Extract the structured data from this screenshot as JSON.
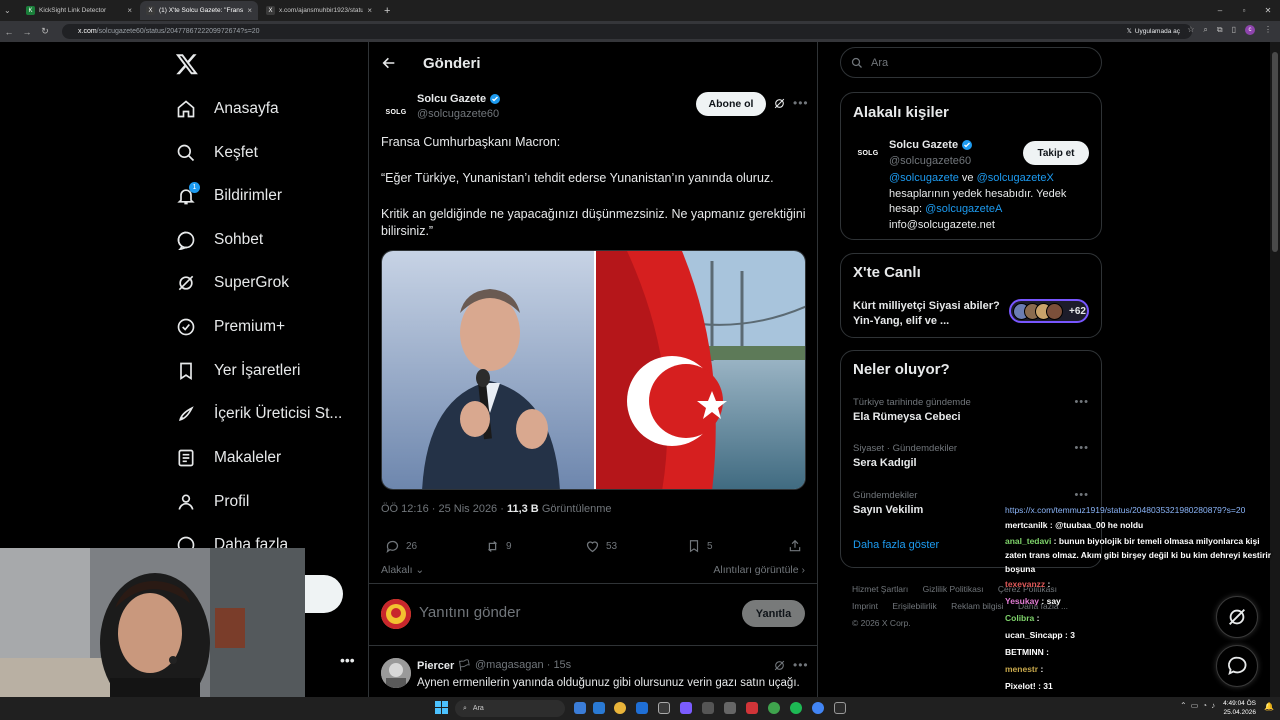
{
  "browser": {
    "tabs": [
      {
        "title": "KickSight Link Detector",
        "fav": "K",
        "active": false
      },
      {
        "title": "(1) X'te Solcu Gazete: \"Fransa C...",
        "fav": "X",
        "active": true
      },
      {
        "title": "x.com/ajansmuhbir1923/status...",
        "fav": "X",
        "active": false
      }
    ],
    "url_host": "x.com",
    "url_path": "/solcugazete60/status/2047786722209972674?s=20",
    "app_chip": "Uygulamada aç"
  },
  "nav": {
    "items": [
      {
        "label": "Anasayfa",
        "icon": "home-icon"
      },
      {
        "label": "Keşfet",
        "icon": "search-icon"
      },
      {
        "label": "Bildirimler",
        "icon": "bell-icon",
        "badge": "1"
      },
      {
        "label": "Sohbet",
        "icon": "chat-icon"
      },
      {
        "label": "SuperGrok",
        "icon": "grok-icon"
      },
      {
        "label": "Premium+",
        "icon": "premium-icon"
      },
      {
        "label": "Yer İşaretleri",
        "icon": "bookmark-icon"
      },
      {
        "label": "İçerik Üreticisi St...",
        "icon": "rocket-icon"
      },
      {
        "label": "Makaleler",
        "icon": "article-icon"
      },
      {
        "label": "Profil",
        "icon": "profile-icon"
      },
      {
        "label": "Daha fazla",
        "icon": "more-circle-icon"
      }
    ]
  },
  "header": {
    "title": "Gönderi"
  },
  "post": {
    "avatar_text": "SOLG",
    "author": "Solcu Gazete",
    "handle": "@solcugazete60",
    "follow_label": "Abone ol",
    "line1": "Fransa Cumhurbaşkanı Macron:",
    "line2": "“Eğer Türkiye, Yunanistan’ı tehdit ederse Yunanistan’ın yanında oluruz.",
    "line3": "Kritik an geldiğinde ne yapacağınızı düşünmezsiniz. Ne yapmanız gerektiğini bilirsiniz.”",
    "time": "ÖÖ 12:16 · 25 Nis 2026 · ",
    "views_count": "11,3 B",
    "views_label": " Görüntülenme",
    "replies": "26",
    "reposts": "9",
    "likes": "53",
    "bookmarks": "5",
    "relevance": "Alakalı",
    "quotes": "Alıntıları görüntüle",
    "reply_placeholder": "Yanıtını gönder",
    "reply_button": "Yanıtla"
  },
  "reply": {
    "name": "Piercer",
    "handle": "@magasagan",
    "age": "15s",
    "text": "Aynen ermenilerin yanında olduğunuz gibi olursunuz verin gazı satın uçağı."
  },
  "right": {
    "search_placeholder": "Ara",
    "relevant_title": "Alakalı kişiler",
    "person_avatar": "SOLG",
    "person_name": "Solcu Gazete",
    "person_handle": "@solcugazete60",
    "person_follow": "Takip et",
    "bio_link1": "@solcugazete",
    "bio_and": " ve ",
    "bio_link2": "@solcugazeteX",
    "bio_text1": " hesaplarının yedek hesabıdır. Yedek hesap: ",
    "bio_link3": "@solcugazeteA",
    "bio_text2": "info@solcugazete.net",
    "live_title": "X'te Canlı",
    "live_text": "Kürt milliyetçi Siyasi abiler?Yin-Yang, elif ve ...",
    "live_count": "+62",
    "trends_title": "Neler oluyor?",
    "trends": [
      {
        "cat": "Türkiye tarihinde gündemde",
        "name": "Ela Rümeysa Cebeci"
      },
      {
        "cat": "Siyaset · Gündemdekiler",
        "name": "Sera Kadıgil"
      },
      {
        "cat": "Gündemdekiler",
        "name": "Sayın Vekilim"
      }
    ],
    "show_more": "Daha fazla göster",
    "footer": [
      "Hizmet Şartları",
      "Gizlilik Politikası",
      "Çerez Politikası",
      "Imprint",
      "Erişilebilirlik",
      "Reklam bilgisi",
      "Daha fazla ...",
      "© 2026 X Corp."
    ]
  },
  "chat": [
    {
      "user": "",
      "text": "https://x.com/temmuz1919/status/2048035321980280879?s=20",
      "color": "#8ab4f8",
      "url": true
    },
    {
      "user": "mertcanilk",
      "text": "@tuubaa_00 he noldu",
      "color": "#ffffff"
    },
    {
      "user": "anal_tedavi",
      "text": "bunun biyolojik bir temeli olmasa milyonlarca kişi zaten trans olmaz. Akım gibi birşey değil ki bu kim dehreyi kestirir boşuna",
      "color": "#7fd46b",
      "wrap": true
    },
    {
      "user": "texevanzz",
      "text": "",
      "color": "#e05a5a"
    },
    {
      "user": "Yesukay",
      "text": "say",
      "color": "#e27cd4"
    },
    {
      "user": "Colibra",
      "text": "",
      "color": "#7fd46b"
    },
    {
      "user": "ucan_Sincapp",
      "text": "3",
      "color": "#ffffff"
    },
    {
      "user": "BETMINN",
      "text": "",
      "color": "#ffffff"
    },
    {
      "user": "menestr",
      "text": "",
      "color": "#c8a84b"
    },
    {
      "user": "Pixelot!",
      "text": "31",
      "color": "#ffffff"
    }
  ],
  "taskbar": {
    "search_label": "Ara",
    "time": "4:49:04 ÖS",
    "date": "25.04.2026"
  }
}
